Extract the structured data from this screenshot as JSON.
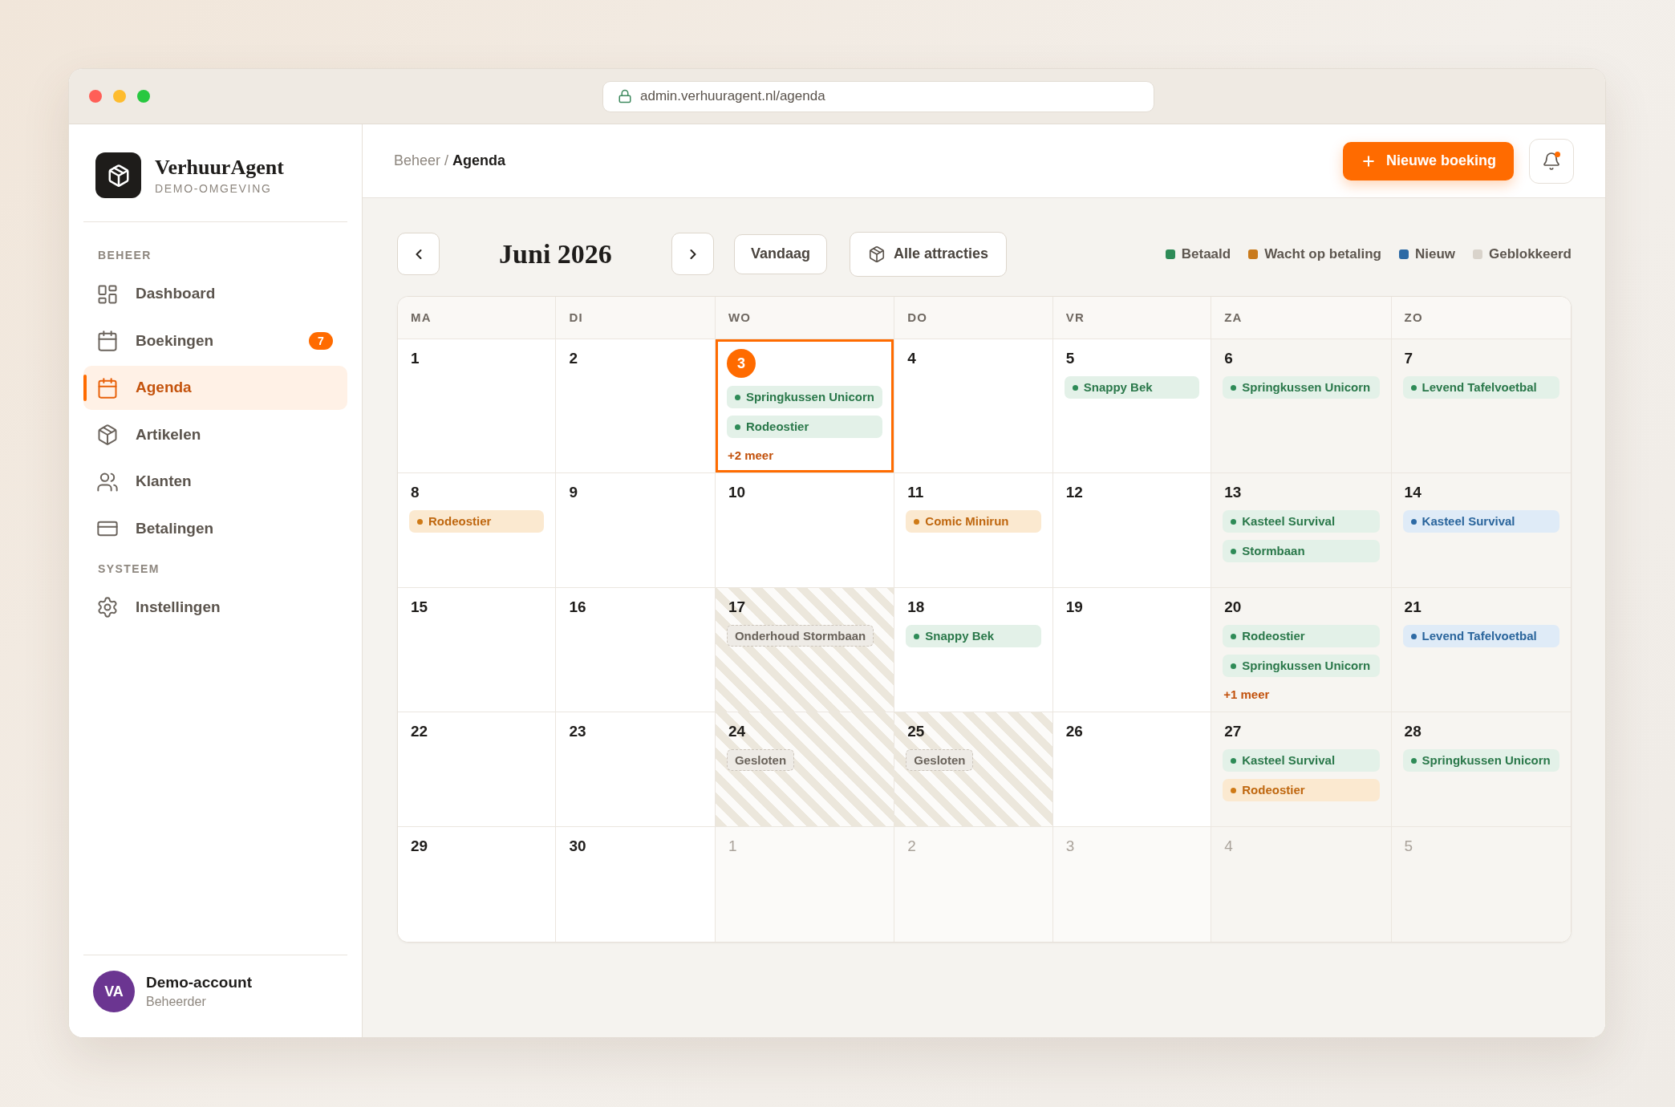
{
  "browser": {
    "url": "admin.verhuuragent.nl/agenda"
  },
  "sidebar": {
    "brand": {
      "name": "VerhuurAgent",
      "tagline": "DEMO-OMGEVING"
    },
    "sections": [
      {
        "title": "BEHEER",
        "items": [
          {
            "label": "Dashboard",
            "selected": false
          },
          {
            "label": "Boekingen",
            "badge": "7",
            "selected": false
          },
          {
            "label": "Agenda",
            "selected": true
          },
          {
            "label": "Artikelen",
            "selected": false
          },
          {
            "label": "Klanten",
            "selected": false
          },
          {
            "label": "Betalingen",
            "selected": false
          }
        ]
      },
      {
        "title": "SYSTEEM",
        "items": [
          {
            "label": "Instellingen",
            "selected": false
          }
        ]
      }
    ],
    "user": {
      "initials": "VA",
      "name": "Demo-account",
      "role": "Beheerder"
    }
  },
  "header": {
    "breadcrumb": "Beheer / **Agenda**",
    "new_booking_button": "Nieuwe boeking",
    "notifications_unread": true
  },
  "toolbar": {
    "month": "Juni 2026",
    "today_button": "Vandaag",
    "filter_button": "Alle attracties"
  },
  "legend": [
    {
      "label": "Betaald",
      "color": "#2e8b57"
    },
    {
      "label": "Wacht op betaling",
      "color": "#c97a1c"
    },
    {
      "label": "Nieuw",
      "color": "#2d6aa5"
    },
    {
      "label": "Geblokkeerd",
      "color": "#d9d3cb"
    }
  ],
  "calendar": {
    "weekdays": [
      {
        "label": "MA",
        "weekend": false
      },
      {
        "label": "DI",
        "weekend": false
      },
      {
        "label": "WO",
        "weekend": false
      },
      {
        "label": "DO",
        "weekend": false
      },
      {
        "label": "VR",
        "weekend": false
      },
      {
        "label": "ZA",
        "weekend": true
      },
      {
        "label": "ZO",
        "weekend": true
      }
    ],
    "weeks": [
      {
        "days": [
          {
            "day": "1",
            "current_month": true,
            "today": false,
            "blocked": false
          },
          {
            "day": "2",
            "current_month": true,
            "today": false,
            "blocked": false
          },
          {
            "day": "3",
            "current_month": true,
            "today": true,
            "blocked": false,
            "events": [
              {
                "title": "Springkussen Unicorn",
                "kind": "paid"
              },
              {
                "title": "Rodeostier",
                "kind": "paid"
              }
            ],
            "more": "+2 meer"
          },
          {
            "day": "4",
            "current_month": true,
            "today": false,
            "blocked": false
          },
          {
            "day": "5",
            "current_month": true,
            "today": false,
            "blocked": false,
            "events": [
              {
                "title": "Snappy Bek",
                "kind": "paid"
              }
            ]
          },
          {
            "day": "6",
            "current_month": true,
            "today": false,
            "blocked": false,
            "events": [
              {
                "title": "Springkussen Unicorn",
                "kind": "paid"
              }
            ]
          },
          {
            "day": "7",
            "current_month": true,
            "today": false,
            "blocked": false,
            "events": [
              {
                "title": "Levend Tafelvoetbal",
                "kind": "paid"
              }
            ]
          }
        ]
      },
      {
        "days": [
          {
            "day": "8",
            "current_month": true,
            "today": false,
            "blocked": false,
            "events": [
              {
                "title": "Rodeostier",
                "kind": "pending"
              }
            ]
          },
          {
            "day": "9",
            "current_month": true,
            "today": false,
            "blocked": false
          },
          {
            "day": "10",
            "current_month": true,
            "today": false,
            "blocked": false
          },
          {
            "day": "11",
            "current_month": true,
            "today": false,
            "blocked": false,
            "events": [
              {
                "title": "Comic Minirun",
                "kind": "pending"
              }
            ]
          },
          {
            "day": "12",
            "current_month": true,
            "today": false,
            "blocked": false
          },
          {
            "day": "13",
            "current_month": true,
            "today": false,
            "blocked": false,
            "events": [
              {
                "title": "Kasteel Survival",
                "kind": "paid"
              },
              {
                "title": "Stormbaan",
                "kind": "paid"
              }
            ]
          },
          {
            "day": "14",
            "current_month": true,
            "today": false,
            "blocked": false,
            "events": [
              {
                "title": "Kasteel Survival",
                "kind": "new"
              }
            ]
          }
        ]
      },
      {
        "days": [
          {
            "day": "15",
            "current_month": true,
            "today": false,
            "blocked": false
          },
          {
            "day": "16",
            "current_month": true,
            "today": false,
            "blocked": false
          },
          {
            "day": "17",
            "current_month": true,
            "today": false,
            "blocked": true,
            "events": [
              {
                "title": "Onderhoud Stormbaan",
                "kind": "blocked"
              }
            ]
          },
          {
            "day": "18",
            "current_month": true,
            "today": false,
            "blocked": false,
            "events": [
              {
                "title": "Snappy Bek",
                "kind": "paid"
              }
            ]
          },
          {
            "day": "19",
            "current_month": true,
            "today": false,
            "blocked": false
          },
          {
            "day": "20",
            "current_month": true,
            "today": false,
            "blocked": false,
            "events": [
              {
                "title": "Rodeostier",
                "kind": "paid"
              },
              {
                "title": "Springkussen Unicorn",
                "kind": "paid"
              }
            ],
            "more": "+1 meer"
          },
          {
            "day": "21",
            "current_month": true,
            "today": false,
            "blocked": false,
            "events": [
              {
                "title": "Levend Tafelvoetbal",
                "kind": "new"
              }
            ]
          }
        ]
      },
      {
        "days": [
          {
            "day": "22",
            "current_month": true,
            "today": false,
            "blocked": false
          },
          {
            "day": "23",
            "current_month": true,
            "today": false,
            "blocked": false
          },
          {
            "day": "24",
            "current_month": true,
            "today": false,
            "blocked": true,
            "events": [
              {
                "title": "Gesloten",
                "kind": "blocked"
              }
            ]
          },
          {
            "day": "25",
            "current_month": true,
            "today": false,
            "blocked": true,
            "events": [
              {
                "title": "Gesloten",
                "kind": "blocked"
              }
            ]
          },
          {
            "day": "26",
            "current_month": true,
            "today": false,
            "blocked": false
          },
          {
            "day": "27",
            "current_month": true,
            "today": false,
            "blocked": false,
            "events": [
              {
                "title": "Kasteel Survival",
                "kind": "paid"
              },
              {
                "title": "Rodeostier",
                "kind": "pending"
              }
            ]
          },
          {
            "day": "28",
            "current_month": true,
            "today": false,
            "blocked": false,
            "events": [
              {
                "title": "Springkussen Unicorn",
                "kind": "paid"
              }
            ]
          }
        ]
      },
      {
        "days": [
          {
            "day": "29",
            "current_month": true,
            "today": false,
            "blocked": false
          },
          {
            "day": "30",
            "current_month": true,
            "today": false,
            "blocked": false
          },
          {
            "day": "1",
            "current_month": false,
            "today": false,
            "blocked": false
          },
          {
            "day": "2",
            "current_month": false,
            "today": false,
            "blocked": false
          },
          {
            "day": "3",
            "current_month": false,
            "today": false,
            "blocked": false
          },
          {
            "day": "4",
            "current_month": false,
            "today": false,
            "blocked": false
          },
          {
            "day": "5",
            "current_month": false,
            "today": false,
            "blocked": false
          }
        ]
      }
    ]
  }
}
